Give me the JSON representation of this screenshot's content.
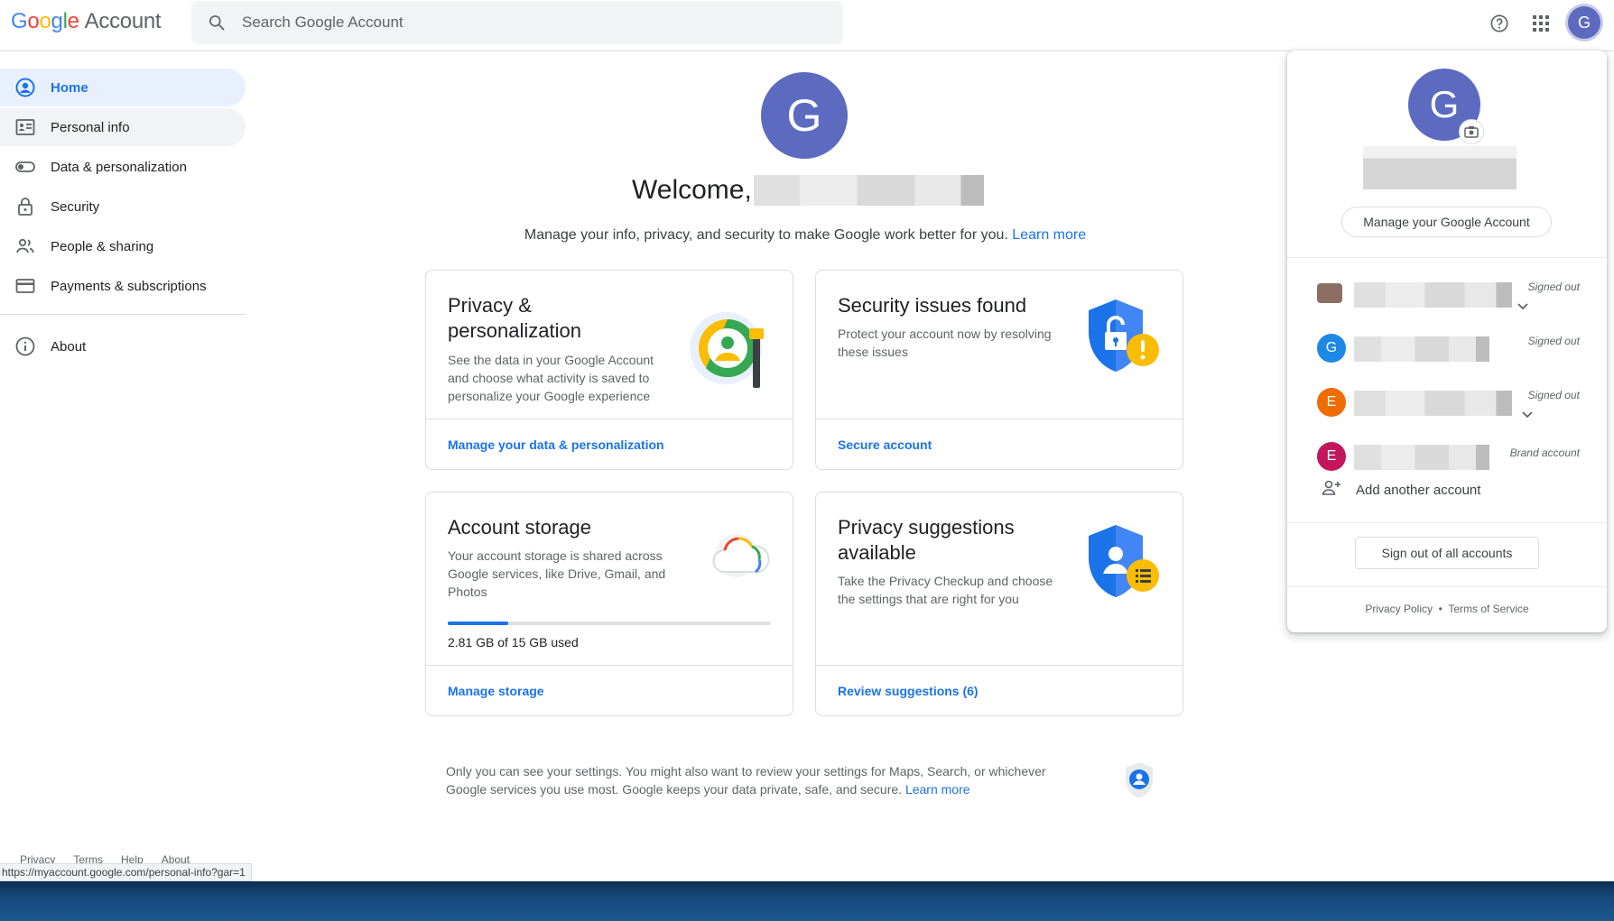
{
  "header": {
    "logo_google": [
      "G",
      "o",
      "o",
      "g",
      "l",
      "e"
    ],
    "logo_account": "Account",
    "search_placeholder": "Search Google Account",
    "avatar_letter": "G"
  },
  "sidebar": {
    "items": [
      {
        "label": "Home",
        "icon": "account-circle-icon"
      },
      {
        "label": "Personal info",
        "icon": "id-card-icon"
      },
      {
        "label": "Data & personalization",
        "icon": "toggle-icon"
      },
      {
        "label": "Security",
        "icon": "lock-icon"
      },
      {
        "label": "People & sharing",
        "icon": "people-icon"
      },
      {
        "label": "Payments & subscriptions",
        "icon": "credit-card-icon"
      }
    ],
    "about": {
      "label": "About",
      "icon": "info-icon"
    }
  },
  "main": {
    "avatar_letter": "G",
    "welcome": "Welcome,",
    "subtitle": "Manage your info, privacy, and security to make Google work better for you.",
    "subtitle_link": "Learn more",
    "cards": {
      "privacy": {
        "title_line1": "Privacy &",
        "title_line2": "personalization",
        "desc": "See the data in your Google Account and choose what activity is saved to personalize your Google experience",
        "action": "Manage your data & personalization"
      },
      "security": {
        "title": "Security issues found",
        "desc": "Protect your account now by resolving these issues",
        "action": "Secure account"
      },
      "storage": {
        "title": "Account storage",
        "desc": "Your account storage is shared across Google services, like Drive, Gmail, and Photos",
        "used_text": "2.81 GB of 15 GB used",
        "used_fraction": 0.187,
        "action": "Manage storage"
      },
      "suggestions": {
        "title_line1": "Privacy suggestions",
        "title_line2": "available",
        "desc": "Take the Privacy Checkup and choose the settings that are right for you",
        "action": "Review suggestions (6)"
      }
    },
    "bottom_note": "Only you can see your settings. You might also want to review your settings for Maps, Search, or whichever Google services you use most. Google keeps your data private, safe, and secure.",
    "bottom_link": "Learn more"
  },
  "footer": {
    "links": [
      "Privacy",
      "Terms",
      "Help",
      "About"
    ],
    "status_url": "https://myaccount.google.com/personal-info?gar=1"
  },
  "popup": {
    "avatar_letter": "G",
    "manage_label": "Manage your Google Account",
    "accounts": [
      {
        "avatar": "",
        "status": "Signed out",
        "color": "#8d6e63"
      },
      {
        "avatar": "G",
        "status": "Signed out",
        "color": "#1e88e5"
      },
      {
        "avatar": "E",
        "status": "Signed out",
        "color": "#ef6c00"
      },
      {
        "avatar": "E",
        "status": "Brand account",
        "color": "#c2185b"
      }
    ],
    "add_account": "Add another account",
    "sign_out_all": "Sign out of all accounts",
    "privacy_policy": "Privacy Policy",
    "dot": "•",
    "terms": "Terms of Service"
  }
}
